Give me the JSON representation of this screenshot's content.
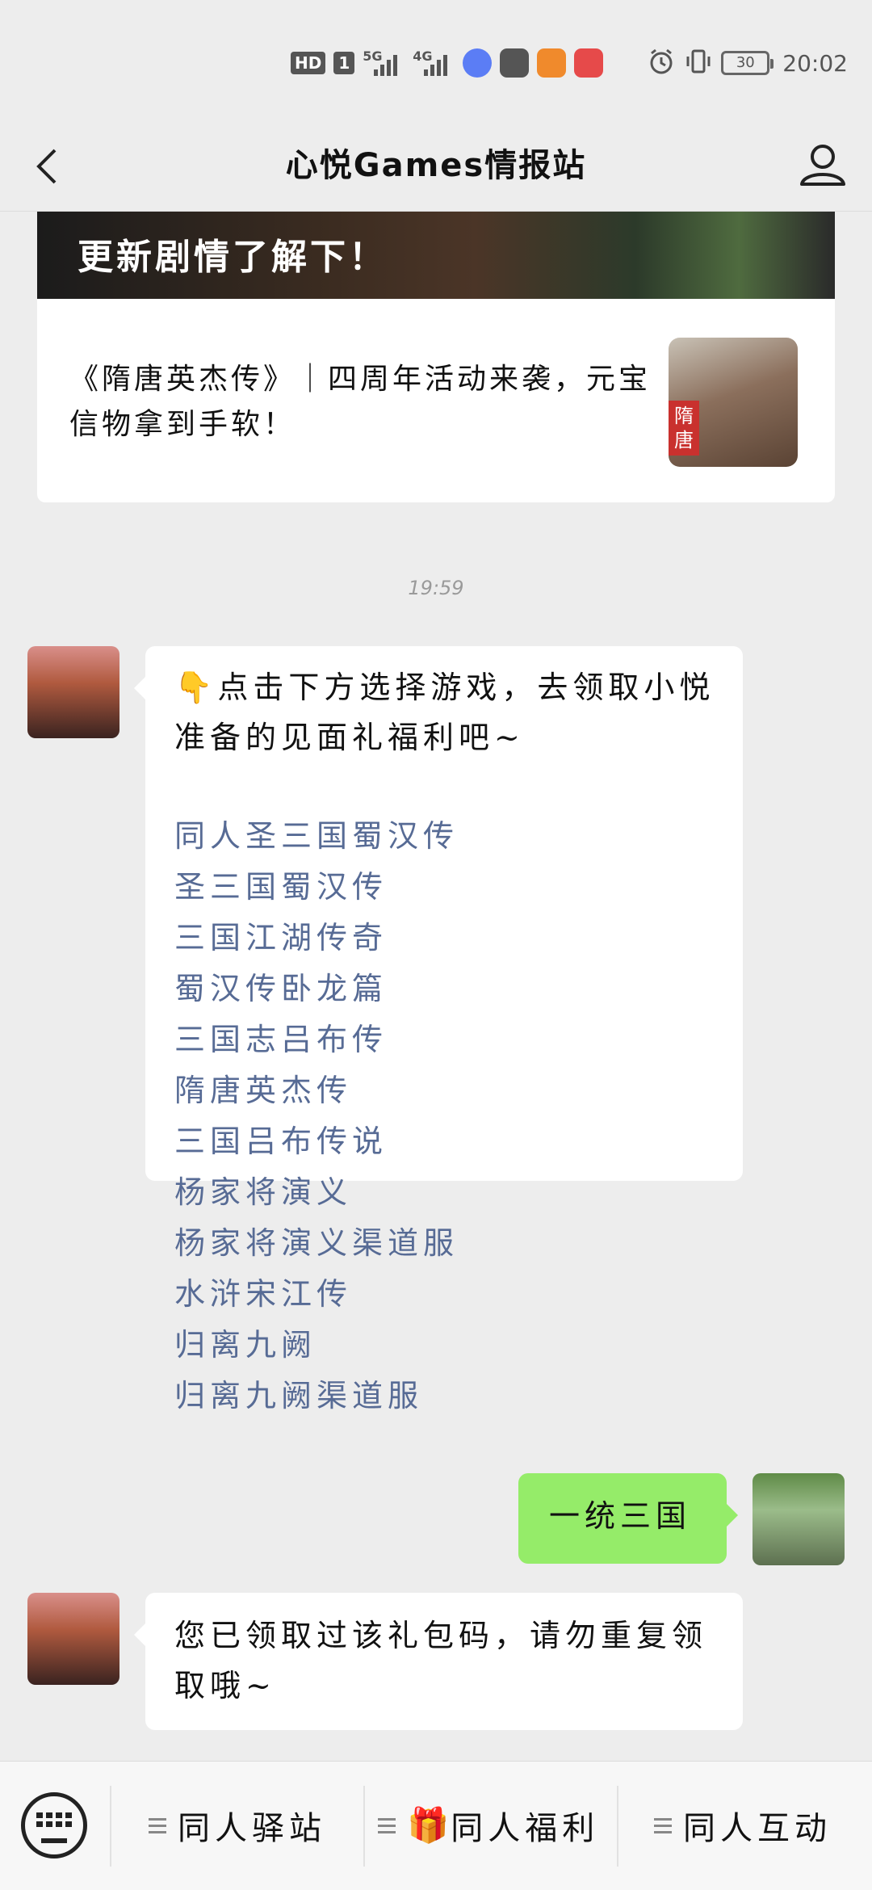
{
  "status_bar": {
    "hd": "HD",
    "sim": "1",
    "net1": "5G",
    "net2": "4G",
    "battery": "30",
    "time": "20:02"
  },
  "header": {
    "title": "心悦Games情报站"
  },
  "article": {
    "banner_text": "更新剧情了解下！",
    "title": "《隋唐英杰传》｜四周年活动来袭，元宝信物拿到手软！",
    "thumb_tag": "隋唐"
  },
  "chat": {
    "timestamp": "19:59",
    "bot_message_1": {
      "intro": "👇点击下方选择游戏，去领取小悦准备的见面礼福利吧~",
      "games": [
        "同人圣三国蜀汉传",
        "圣三国蜀汉传",
        "三国江湖传奇",
        "蜀汉传卧龙篇",
        "三国志吕布传",
        "隋唐英杰传",
        "三国吕布传说",
        "杨家将演义",
        "杨家将演义渠道服",
        "水浒宋江传",
        "归离九阙",
        "归离九阙渠道服"
      ]
    },
    "user_message": "一统三国",
    "bot_message_2": "您已领取过该礼包码，请勿重复领取哦~"
  },
  "bottom_menu": {
    "item1": "同人驿站",
    "item2_icon": "🎁",
    "item2": "同人福利",
    "item3": "同人互动"
  }
}
